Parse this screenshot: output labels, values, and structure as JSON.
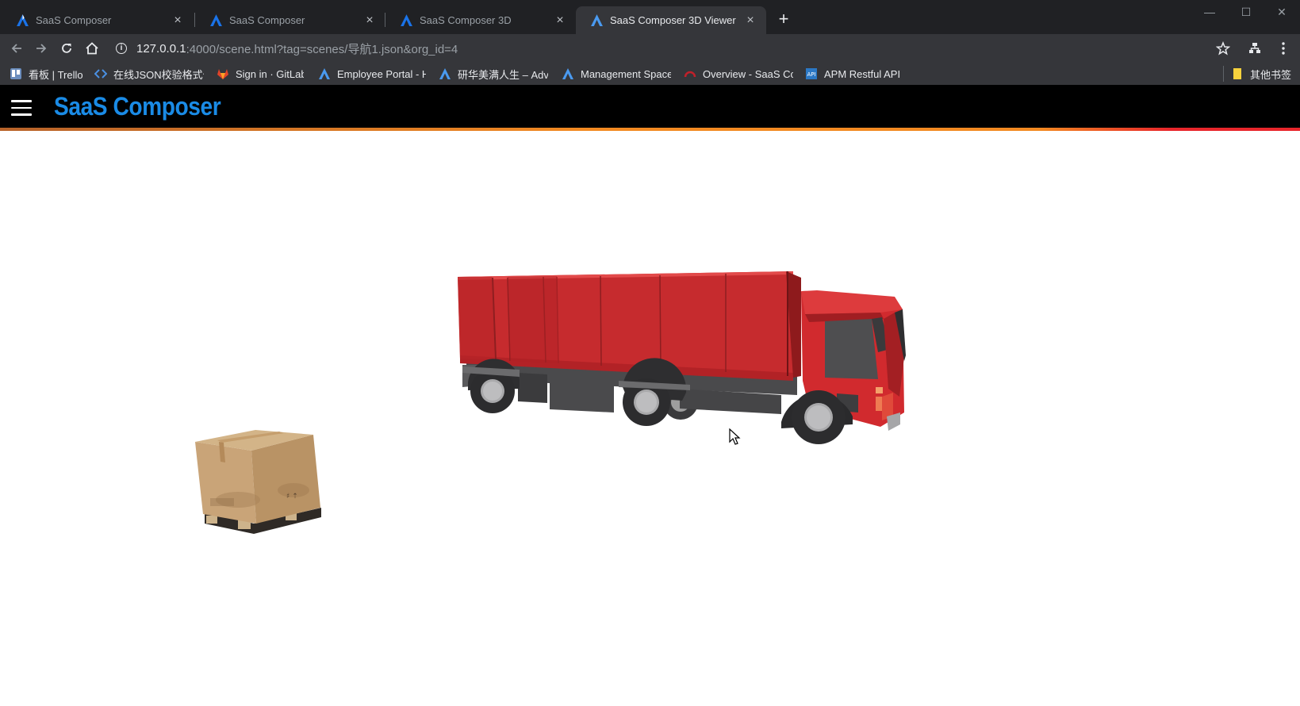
{
  "browser": {
    "tabs": [
      {
        "title": "SaaS Composer",
        "active": false
      },
      {
        "title": "SaaS Composer",
        "active": false
      },
      {
        "title": "SaaS Composer 3D",
        "active": false
      },
      {
        "title": "SaaS Composer 3D Viewer",
        "active": true
      }
    ],
    "tab_close_glyph": "×",
    "new_tab_glyph": "+",
    "window_controls": {
      "minimize": "—",
      "maximize": "☐",
      "close": "✕"
    },
    "url": {
      "host": "127.0.0.1",
      "path": ":4000/scene.html?tag=scenes/导航1.json&org_id=4"
    },
    "bookmarks": [
      {
        "label": "看板 | Trello",
        "icon": "trello-icon"
      },
      {
        "label": "在线JSON校验格式化",
        "icon": "code-icon"
      },
      {
        "label": "Sign in · GitLab",
        "icon": "gitlab-icon"
      },
      {
        "label": "Employee Portal - H",
        "icon": "advantech-icon"
      },
      {
        "label": "研华美满人生 – Adva",
        "icon": "advantech-icon"
      },
      {
        "label": "Management Space",
        "icon": "advantech-icon"
      },
      {
        "label": "Overview - SaaS Co",
        "icon": "overview-icon"
      },
      {
        "label": "APM Restful API",
        "icon": "api-icon"
      }
    ],
    "other_bookmarks": "其他书签"
  },
  "app": {
    "brand": "SaaS Composer",
    "brand_color": "#1a8be6"
  },
  "scene": {
    "objects": [
      "dump-truck",
      "cardboard-box-on-pallet"
    ],
    "truck_color": "#c62b2e"
  }
}
